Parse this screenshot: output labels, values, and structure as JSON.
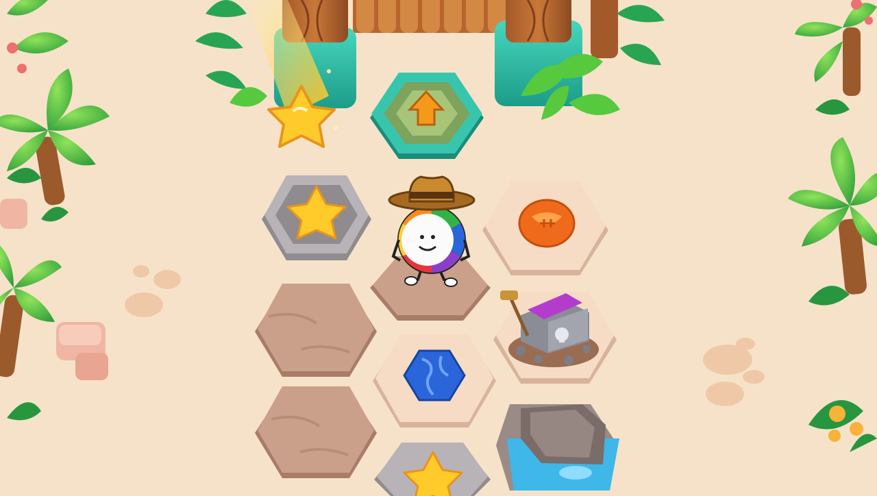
{
  "scene": {
    "type": "board-game-map",
    "theme": "tropical-beach",
    "sand_color": "#f6e2c9"
  },
  "hud": {
    "falling_star": {
      "icon": "star-icon",
      "state": "collected-falling",
      "color": "#ffcb2b"
    }
  },
  "board": {
    "tiles": [
      {
        "id": "exit",
        "kind": "arrow-up",
        "material": "teal-stone",
        "icon": "arrow-up-icon",
        "color": "#2fb9a3"
      },
      {
        "id": "star-1",
        "kind": "star",
        "material": "grey-stone",
        "icon": "star-icon",
        "color": "#ffcb2b"
      },
      {
        "id": "player",
        "kind": "dirt",
        "material": "dirt",
        "occupant": "hat-wearing-wheel-character"
      },
      {
        "id": "sports",
        "kind": "category",
        "material": "sand-stone",
        "icon": "football-icon",
        "color": "#f06a1c"
      },
      {
        "id": "empty-1",
        "kind": "dirt",
        "material": "dirt"
      },
      {
        "id": "treasure",
        "kind": "treasure-chest",
        "material": "sand-stone",
        "icon": "treasure-chest-icon",
        "color": "#9b46c9"
      },
      {
        "id": "geography",
        "kind": "category",
        "material": "sand-stone",
        "icon": "globe-icon",
        "color": "#2a66d9"
      },
      {
        "id": "empty-2",
        "kind": "dirt",
        "material": "dirt"
      },
      {
        "id": "water",
        "kind": "water-hole",
        "material": "cliff",
        "icon": "water-icon",
        "color": "#3fb7e8"
      },
      {
        "id": "star-2",
        "kind": "star",
        "material": "grey-stone",
        "icon": "star-icon",
        "color": "#ffcb2b"
      }
    ]
  },
  "character": {
    "name_icon": "character-avatar-icon",
    "hat": "cowboy-hat",
    "wheel_colors": [
      "#e8343b",
      "#8a3fc9",
      "#2a66d9",
      "#32b34a",
      "#ffcc33",
      "#ff8a1f"
    ]
  }
}
